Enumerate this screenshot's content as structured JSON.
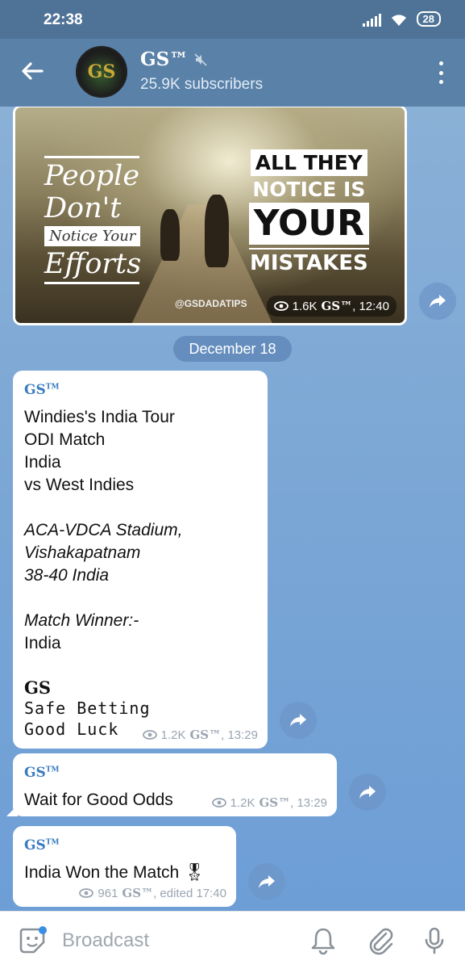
{
  "status": {
    "time": "22:38",
    "battery": "28"
  },
  "header": {
    "title": "GS™",
    "subtitle": "25.9K subscribers",
    "avatar_text": "GS"
  },
  "photo_post": {
    "image_text": {
      "left": [
        "People",
        "Don't",
        "Notice Your",
        "Efforts"
      ],
      "right": [
        "ALL THEY",
        "NOTICE IS",
        "YOUR",
        "MISTAKES"
      ],
      "tag": "@GSDADATIPS"
    },
    "views": "1.6K",
    "author": "GS™",
    "time": ", 12:40"
  },
  "date_separator": "December 18",
  "messages": [
    {
      "sender": "GS",
      "lines": {
        "l1": "Windies's India Tour",
        "l2": "ODI Match",
        "l3": "India",
        "l4": "vs West Indies",
        "l5": "ACA-VDCA Stadium,",
        "l6": "Vishakapatnam",
        "l7": "38-40 India",
        "l8": "Match Winner:-",
        "l9": "India",
        "l10": "GS",
        "l11": "Safe Betting",
        "l12": "Good Luck"
      },
      "views": "1.2K",
      "author": "GS™",
      "time": ", 13:29"
    },
    {
      "sender": "GS",
      "text": "Wait for Good Odds",
      "views": "1.2K",
      "author": "GS™",
      "time": ", 13:29"
    },
    {
      "sender": "GS",
      "text": "India Won the Match 🎖",
      "views": "961",
      "author": "GS™",
      "time": ", edited 17:40"
    }
  ],
  "input": {
    "placeholder": "Broadcast"
  },
  "icons": {
    "back": "arrow-left-icon",
    "mute": "muted-speaker-icon",
    "menu": "more-vertical-icon",
    "views": "eye-icon",
    "forward": "share-forward-icon",
    "sticker": "sticker-icon",
    "bell": "bell-icon",
    "attach": "paperclip-icon",
    "mic": "microphone-icon"
  },
  "colors": {
    "header": "#5a81a8",
    "statusbar": "#4f7397",
    "accent": "#3a7bbf"
  }
}
